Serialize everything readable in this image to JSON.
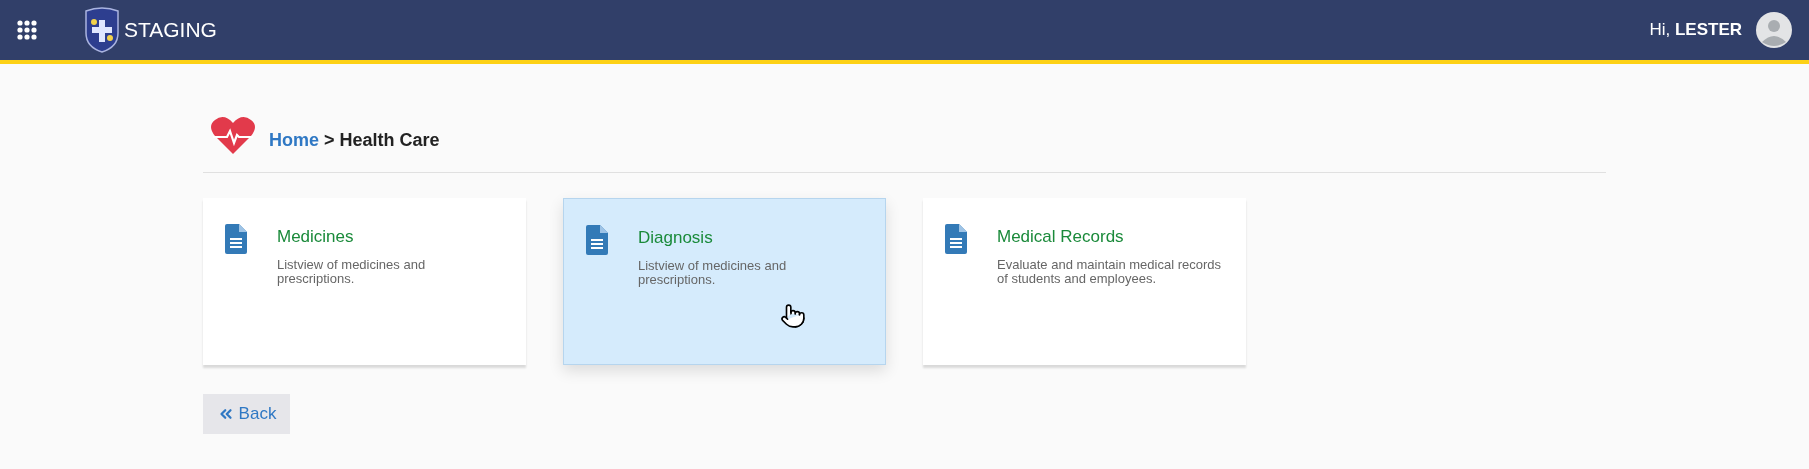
{
  "header": {
    "title": "STAGING",
    "greeting": "Hi,",
    "user": "LESTER"
  },
  "breadcrumb": {
    "home": "Home",
    "separator": ">",
    "current": "Health Care"
  },
  "cards": [
    {
      "title": "Medicines",
      "description": "Listview of medicines and prescriptions.",
      "hovered": false
    },
    {
      "title": "Diagnosis",
      "description": "Listview of medicines and prescriptions.",
      "hovered": true
    },
    {
      "title": "Medical Records",
      "description": "Evaluate and maintain medical records of students and employees.",
      "hovered": false
    }
  ],
  "back_button": {
    "label": "Back"
  }
}
